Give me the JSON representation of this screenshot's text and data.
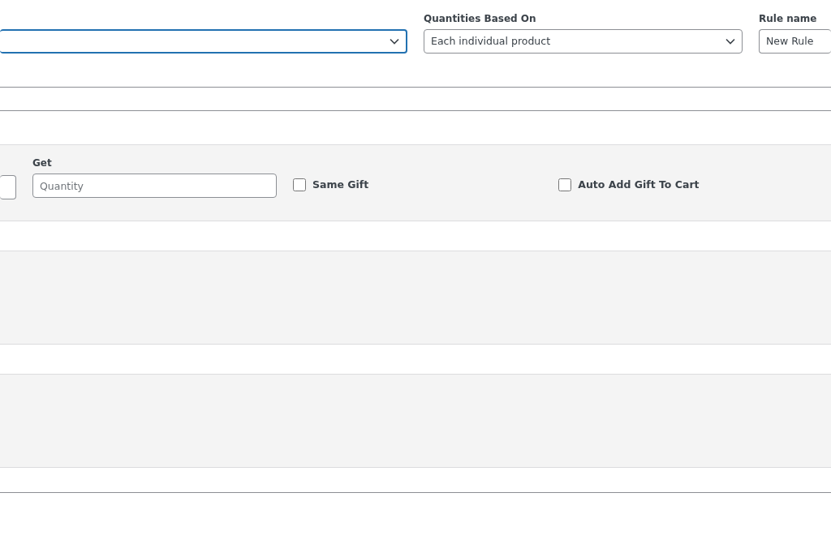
{
  "top_fields": [
    {
      "kind": "select",
      "focused": true
    },
    {
      "kind": "select",
      "label": "Quantities Based On",
      "value": "Each individual product",
      "focused": false
    },
    {
      "kind": "input",
      "label": "Rule name",
      "value": "New Rule",
      "focused": false
    }
  ],
  "gift_row": {
    "get_label": "Get",
    "get_placeholder": "Quantity",
    "checkboxes": [
      {
        "label": "Same Gift",
        "checked": false
      },
      {
        "label": "Auto Add Gift To Cart",
        "checked": false
      }
    ]
  }
}
